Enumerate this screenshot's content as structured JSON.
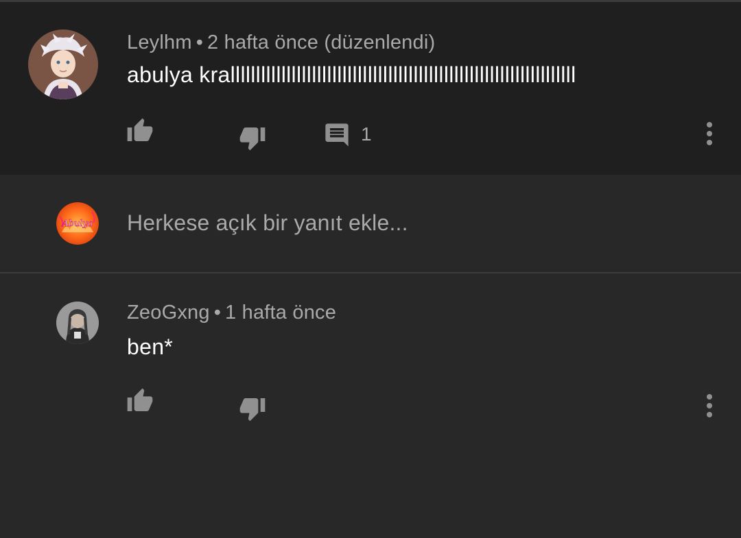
{
  "parent_comment": {
    "author": "Leylhm",
    "separator": "•",
    "time": "2 hafta önce (düzenlendi)",
    "text": "abulya krallllllllllllllllllllllllllllllllllllllllllllllllllllllllllllllllllll",
    "reply_count": "1",
    "avatar_icon": "user-avatar-anime",
    "like_icon": "thumb-up-icon",
    "dislike_icon": "thumb-down-icon",
    "reply_icon": "comment-icon",
    "more_icon": "more-vert-icon"
  },
  "reply_box": {
    "placeholder": "Herkese açık bir yanıt ekle...",
    "avatar_icon": "channel-avatar-abulya",
    "avatar_text": "Abulya"
  },
  "reply_comment": {
    "author": "ZeoGxng",
    "separator": "•",
    "time": "1 hafta önce",
    "text": "ben*",
    "avatar_icon": "user-avatar-photo",
    "like_icon": "thumb-up-icon",
    "dislike_icon": "thumb-down-icon",
    "more_icon": "more-vert-icon"
  },
  "colors": {
    "background": "#282828",
    "parent_background": "#1f1f1f",
    "secondary_text": "#aaaaaa",
    "primary_text": "#ffffff",
    "icon": "#909090"
  }
}
